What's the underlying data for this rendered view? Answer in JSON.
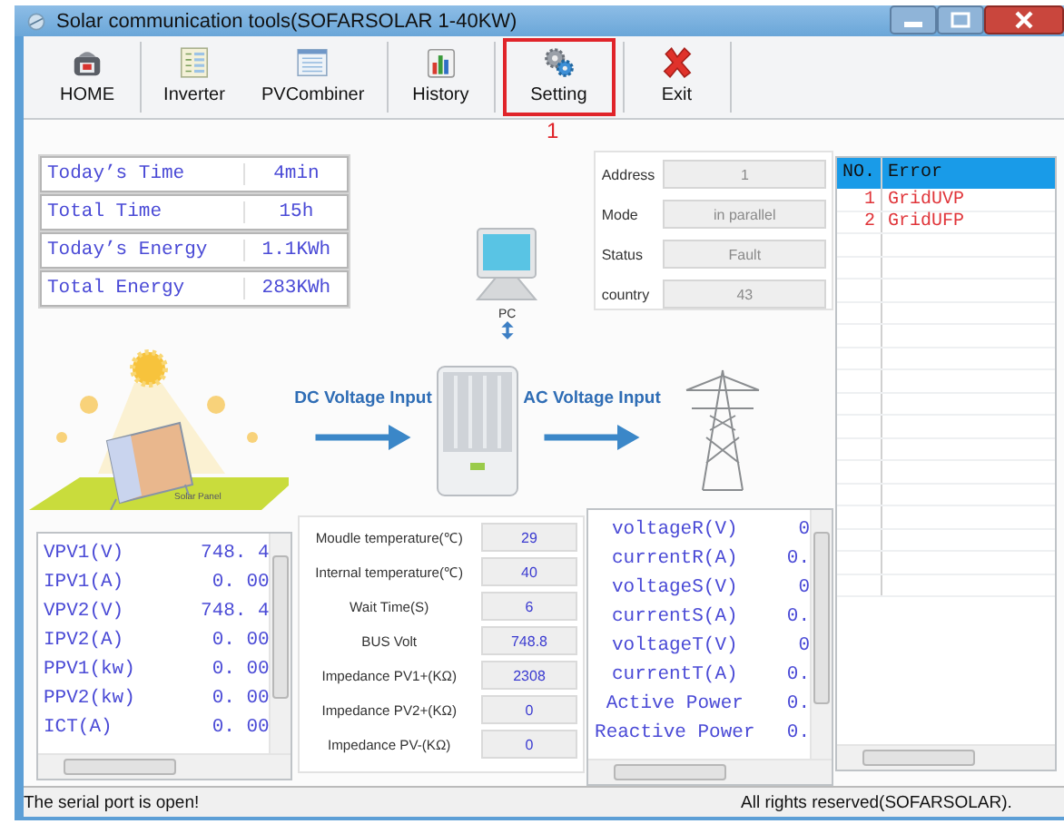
{
  "window": {
    "title": "Solar communication tools(SOFARSOLAR 1-40KW)"
  },
  "toolbar": [
    {
      "label": "HOME",
      "kind": "home",
      "selected": false,
      "separator_after": true
    },
    {
      "label": "Inverter",
      "kind": "inverter",
      "selected": false,
      "separator_after": false
    },
    {
      "label": "PVCombiner",
      "kind": "combiner",
      "selected": false,
      "separator_after": true
    },
    {
      "label": "History",
      "kind": "history",
      "selected": false,
      "separator_after": true
    },
    {
      "label": "Setting",
      "kind": "setting",
      "selected": true,
      "separator_after": true
    },
    {
      "label": "Exit",
      "kind": "exit",
      "selected": false,
      "separator_after": true
    }
  ],
  "callout": "1",
  "summary": [
    {
      "label": "Today’s Time",
      "value": "4min"
    },
    {
      "label": "Total Time",
      "value": "15h"
    },
    {
      "label": "Today’s Energy",
      "value": "1.1KWh"
    },
    {
      "label": "Total Energy",
      "value": "283KWh"
    }
  ],
  "device": {
    "label": "PC"
  },
  "info": [
    {
      "label": "Address",
      "value": "1",
      "disabled": true
    },
    {
      "label": "Mode",
      "value": "in parallel",
      "disabled": true
    },
    {
      "label": "Status",
      "value": "Fault",
      "disabled": true
    },
    {
      "label": "country",
      "value": "43",
      "disabled": true
    }
  ],
  "diagram": {
    "panel_label": "Solar Panel",
    "dc_label": "DC Voltage Input",
    "ac_label": "AC Voltage Input"
  },
  "pv_list": [
    {
      "label": "VPV1(V)",
      "value": "748. 4"
    },
    {
      "label": "IPV1(A)",
      "value": "0. 00"
    },
    {
      "label": "VPV2(V)",
      "value": "748. 4"
    },
    {
      "label": "IPV2(A)",
      "value": "0. 00"
    },
    {
      "label": "PPV1(kw)",
      "value": "0. 00"
    },
    {
      "label": "PPV2(kw)",
      "value": "0. 00"
    },
    {
      "label": "ICT(A)",
      "value": "0. 00"
    }
  ],
  "parameters": [
    {
      "label": "Moudle temperature(℃)",
      "value": "29"
    },
    {
      "label": "Internal temperature(℃)",
      "value": "40"
    },
    {
      "label": "Wait Time(S)",
      "value": "6"
    },
    {
      "label": "BUS Volt",
      "value": "748.8"
    },
    {
      "label": "Impedance PV1+(KΩ)",
      "value": "2308"
    },
    {
      "label": "Impedance PV2+(KΩ)",
      "value": "0"
    },
    {
      "label": "Impedance PV-(KΩ)",
      "value": "0"
    }
  ],
  "ac_list": [
    {
      "label": "voltageR(V)",
      "value": "0"
    },
    {
      "label": "currentR(A)",
      "value": "0."
    },
    {
      "label": "voltageS(V)",
      "value": "0"
    },
    {
      "label": "currentS(A)",
      "value": "0."
    },
    {
      "label": "voltageT(V)",
      "value": "0"
    },
    {
      "label": "currentT(A)",
      "value": "0."
    },
    {
      "label": "Active Power",
      "value": "0."
    },
    {
      "label": "Reactive Power",
      "value": "0."
    }
  ],
  "errors": {
    "columns": [
      "NO.",
      "Error"
    ],
    "rows": [
      {
        "no": "1",
        "error": "GridUVP"
      },
      {
        "no": "2",
        "error": "GridUFP"
      }
    ]
  },
  "status_bar": {
    "left": "The serial port is open!",
    "right": "All rights reserved(SOFARSOLAR)."
  }
}
